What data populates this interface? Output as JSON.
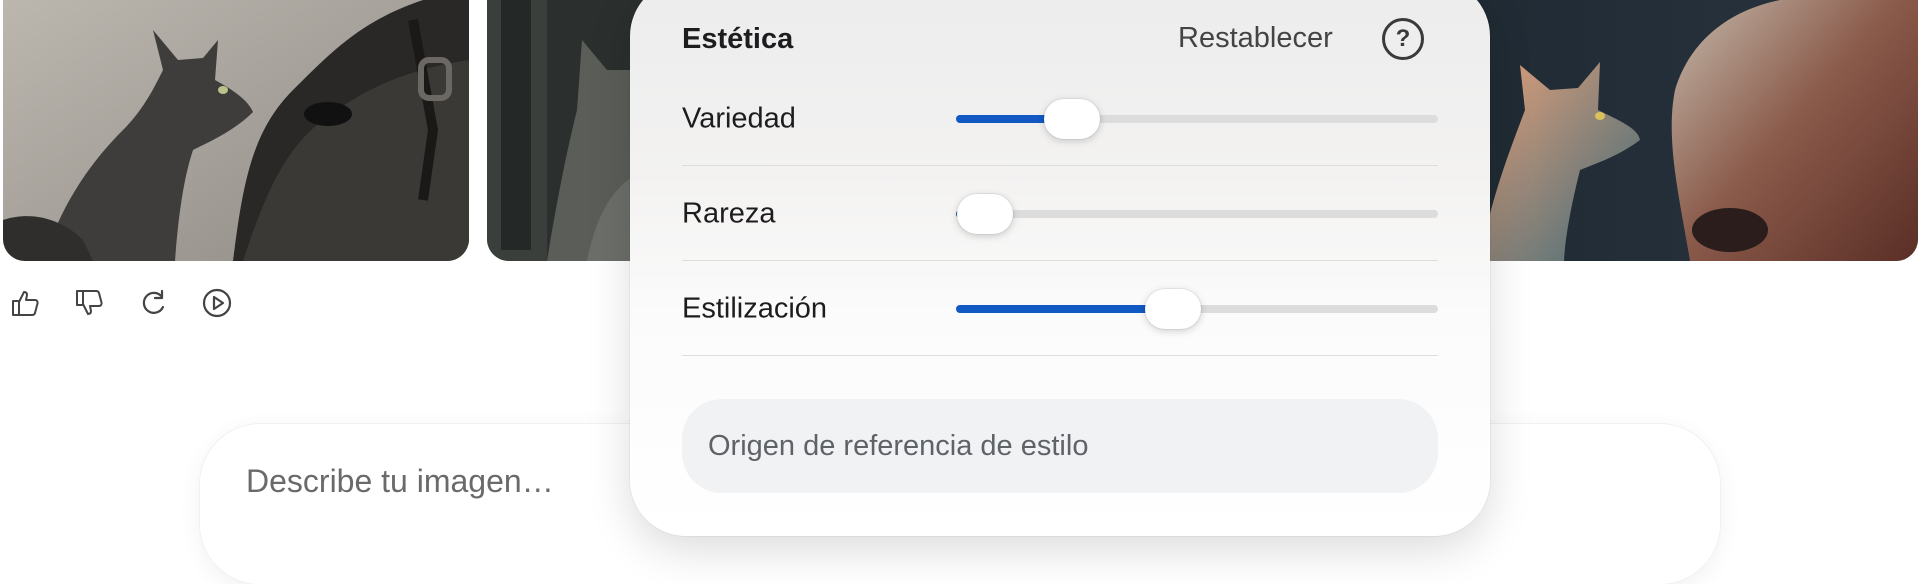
{
  "panel": {
    "title": "Estética",
    "reset_label": "Restablecer",
    "help_icon": "question-circle-icon",
    "help_glyph": "?",
    "sliders": [
      {
        "label": "Variedad",
        "value_fraction": 0.24
      },
      {
        "label": "Rareza",
        "value_fraction": 0.06
      },
      {
        "label": "Estilización",
        "value_fraction": 0.45
      }
    ],
    "style_reference_label": "Origen de referencia de estilo"
  },
  "actions": {
    "icons": [
      "thumbs-up-icon",
      "thumbs-down-icon",
      "regenerate-icon",
      "play-circle-icon"
    ]
  },
  "prompt": {
    "placeholder": "Describe tu imagen…"
  },
  "colors": {
    "accent": "#1259c3",
    "track": "#dcdcdc",
    "panel_bg": "#f4f4f4",
    "input_bg": "#f1f2f4"
  }
}
